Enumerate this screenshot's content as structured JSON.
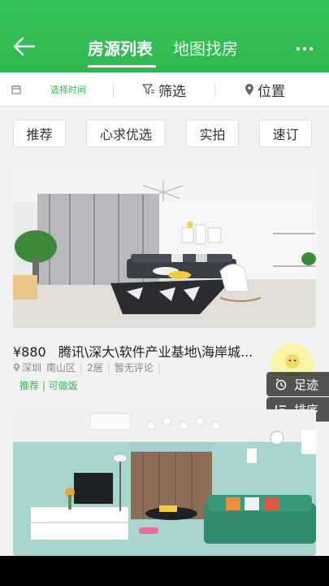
{
  "header": {
    "tabs": [
      {
        "label": "房源列表",
        "active": true
      },
      {
        "label": "地图找房",
        "active": false
      }
    ]
  },
  "filter_bar": {
    "date_label": "选择时间",
    "filter_label": "筛选",
    "location_label": "位置"
  },
  "quick_filters": [
    "推荐",
    "心求优选",
    "实拍",
    "速订"
  ],
  "listings": [
    {
      "price": "¥880",
      "title": "腾讯\\深大\\软件产业基地\\海岸城...",
      "city": "深圳",
      "district": "南山区",
      "rooms": "2居",
      "reviews": "暂无评论",
      "tags": "推荐 | 可做饭"
    }
  ],
  "floating": {
    "footprint_label": "足迹",
    "sort_label": "排序"
  },
  "colors": {
    "brand": "#2fb84f",
    "header_bg": "#36c25b"
  }
}
